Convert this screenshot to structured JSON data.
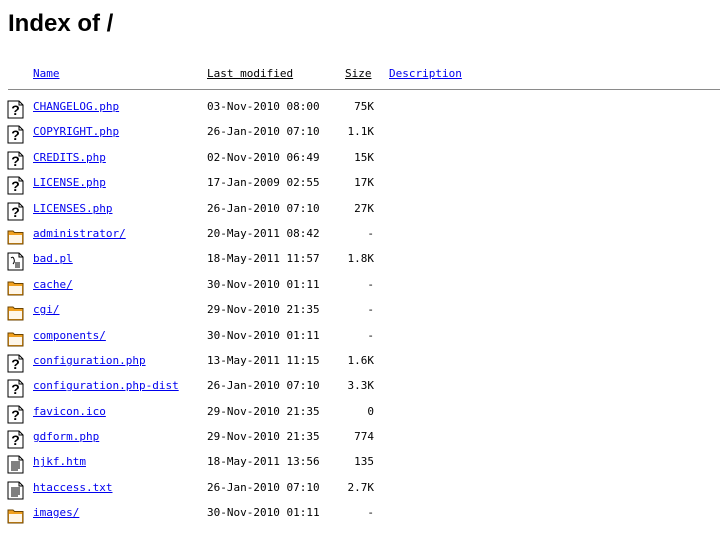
{
  "page": {
    "heading": "Index of /"
  },
  "columns": {
    "name": "Name",
    "last_modified": "Last modified",
    "size": "Size",
    "description": "Description"
  },
  "entries": [
    {
      "name": "CHANGELOG.php",
      "modified": "03-Nov-2010 08:00",
      "size": "75K",
      "icon": "unknown-file-icon"
    },
    {
      "name": "COPYRIGHT.php",
      "modified": "26-Jan-2010 07:10",
      "size": "1.1K",
      "icon": "unknown-file-icon"
    },
    {
      "name": "CREDITS.php",
      "modified": "02-Nov-2010 06:49",
      "size": "15K",
      "icon": "unknown-file-icon"
    },
    {
      "name": "LICENSE.php",
      "modified": "17-Jan-2009 02:55",
      "size": "17K",
      "icon": "unknown-file-icon"
    },
    {
      "name": "LICENSES.php",
      "modified": "26-Jan-2010 07:10",
      "size": "27K",
      "icon": "unknown-file-icon"
    },
    {
      "name": "administrator/",
      "modified": "20-May-2011 08:42",
      "size": "-",
      "icon": "folder-icon"
    },
    {
      "name": "bad.pl",
      "modified": "18-May-2011 11:57",
      "size": "1.8K",
      "icon": "script-file-icon"
    },
    {
      "name": "cache/",
      "modified": "30-Nov-2010 01:11",
      "size": "-",
      "icon": "folder-icon"
    },
    {
      "name": "cgi/",
      "modified": "29-Nov-2010 21:35",
      "size": "-",
      "icon": "folder-icon"
    },
    {
      "name": "components/",
      "modified": "30-Nov-2010 01:11",
      "size": "-",
      "icon": "folder-icon"
    },
    {
      "name": "configuration.php",
      "modified": "13-May-2011 11:15",
      "size": "1.6K",
      "icon": "unknown-file-icon"
    },
    {
      "name": "configuration.php-dist",
      "modified": "26-Jan-2010 07:10",
      "size": "3.3K",
      "icon": "unknown-file-icon"
    },
    {
      "name": "favicon.ico",
      "modified": "29-Nov-2010 21:35",
      "size": "0",
      "icon": "unknown-file-icon"
    },
    {
      "name": "gdform.php",
      "modified": "29-Nov-2010 21:35",
      "size": "774",
      "icon": "unknown-file-icon"
    },
    {
      "name": "hjkf.htm",
      "modified": "18-May-2011 13:56",
      "size": "135",
      "icon": "text-file-icon"
    },
    {
      "name": "htaccess.txt",
      "modified": "26-Jan-2010 07:10",
      "size": "2.7K",
      "icon": "text-file-icon"
    },
    {
      "name": "images/",
      "modified": "30-Nov-2010 01:11",
      "size": "-",
      "icon": "folder-icon"
    }
  ],
  "colors": {
    "link": "#0000ee",
    "folder": "#f0a020",
    "rule": "#8a8a8a"
  }
}
